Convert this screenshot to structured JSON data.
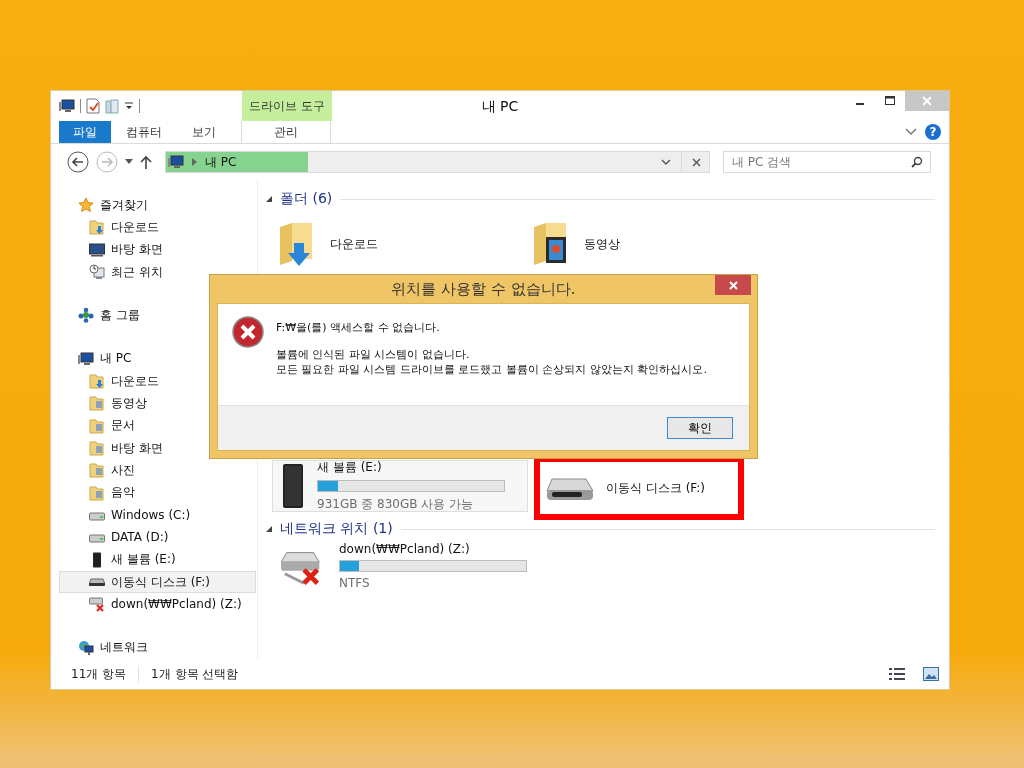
{
  "window": {
    "title": "내 PC"
  },
  "ribbon": {
    "context_header": "드라이브 도구",
    "help": "?",
    "tabs": [
      {
        "label": "파일",
        "kind": "file"
      },
      {
        "label": "컴퓨터",
        "kind": "normal"
      },
      {
        "label": "보기",
        "kind": "normal"
      },
      {
        "label": "관리",
        "kind": "context"
      }
    ]
  },
  "address": {
    "path": "내 PC"
  },
  "search": {
    "placeholder": "내 PC 검색"
  },
  "sidebar": {
    "items": [
      {
        "label": "즐겨찾기",
        "kind": "star",
        "selected": false,
        "children": [
          {
            "label": "다운로드",
            "kind": "download",
            "selected": false
          },
          {
            "label": "바탕 화면",
            "kind": "monitor",
            "selected": false
          },
          {
            "label": "최근 위치",
            "kind": "recent",
            "selected": false
          }
        ]
      },
      {
        "label": "홈 그룹",
        "kind": "homegroup",
        "selected": false
      },
      {
        "label": "내 PC",
        "kind": "pc",
        "selected": false,
        "children": [
          {
            "label": "다운로드",
            "kind": "download",
            "selected": false
          },
          {
            "label": "동영상",
            "kind": "folder",
            "selected": false
          },
          {
            "label": "문서",
            "kind": "folder",
            "selected": false
          },
          {
            "label": "바탕 화면",
            "kind": "folder",
            "selected": false
          },
          {
            "label": "사진",
            "kind": "folder",
            "selected": false
          },
          {
            "label": "음악",
            "kind": "folder",
            "selected": false
          },
          {
            "label": "Windows (C:)",
            "kind": "drive",
            "selected": false
          },
          {
            "label": "DATA (D:)",
            "kind": "drive",
            "selected": false
          },
          {
            "label": "새 볼륨 (E:)",
            "kind": "external",
            "selected": false
          },
          {
            "label": "이동식 디스크 (F:)",
            "kind": "usb",
            "selected": true
          },
          {
            "label": "down(₩₩Pcland) (Z:)",
            "kind": "netdrive",
            "selected": false
          }
        ]
      },
      {
        "label": "네트워크",
        "kind": "network",
        "selected": false
      }
    ]
  },
  "folders": {
    "title": "폴더 (6)",
    "items": [
      {
        "name": "다운로드",
        "kind": "download"
      },
      {
        "name": "동영상",
        "kind": "video"
      }
    ]
  },
  "drives": [
    {
      "name": "새 볼륨 (E:)",
      "kind": "external",
      "level": 0.11,
      "detail": "931GB 중 830GB 사용 가능",
      "hot": true,
      "highlighted": false
    },
    {
      "name": "이동식 디스크 (F:)",
      "kind": "usb",
      "hot": false,
      "highlighted": true
    }
  ],
  "network": {
    "title": "네트워크 위치 (1)",
    "items": [
      {
        "name": "down(₩₩Pcland) (Z:)",
        "kind": "netdrive",
        "level": 0.1,
        "detail": "NTFS"
      }
    ]
  },
  "status_bar": {
    "count": "11개 항목",
    "selection": "1개 항목 선택함"
  },
  "dialog": {
    "title": "위치를 사용할 수 없습니다.",
    "lines": [
      "F:₩을(를) 액세스할 수 없습니다.",
      "볼륨에 인식된 파일 시스템이 없습니다.\n모든 필요한 파일 시스템 드라이브를 로드했고 볼륨이 손상되지 않았는지 확인하십시오."
    ],
    "button": "확인"
  }
}
